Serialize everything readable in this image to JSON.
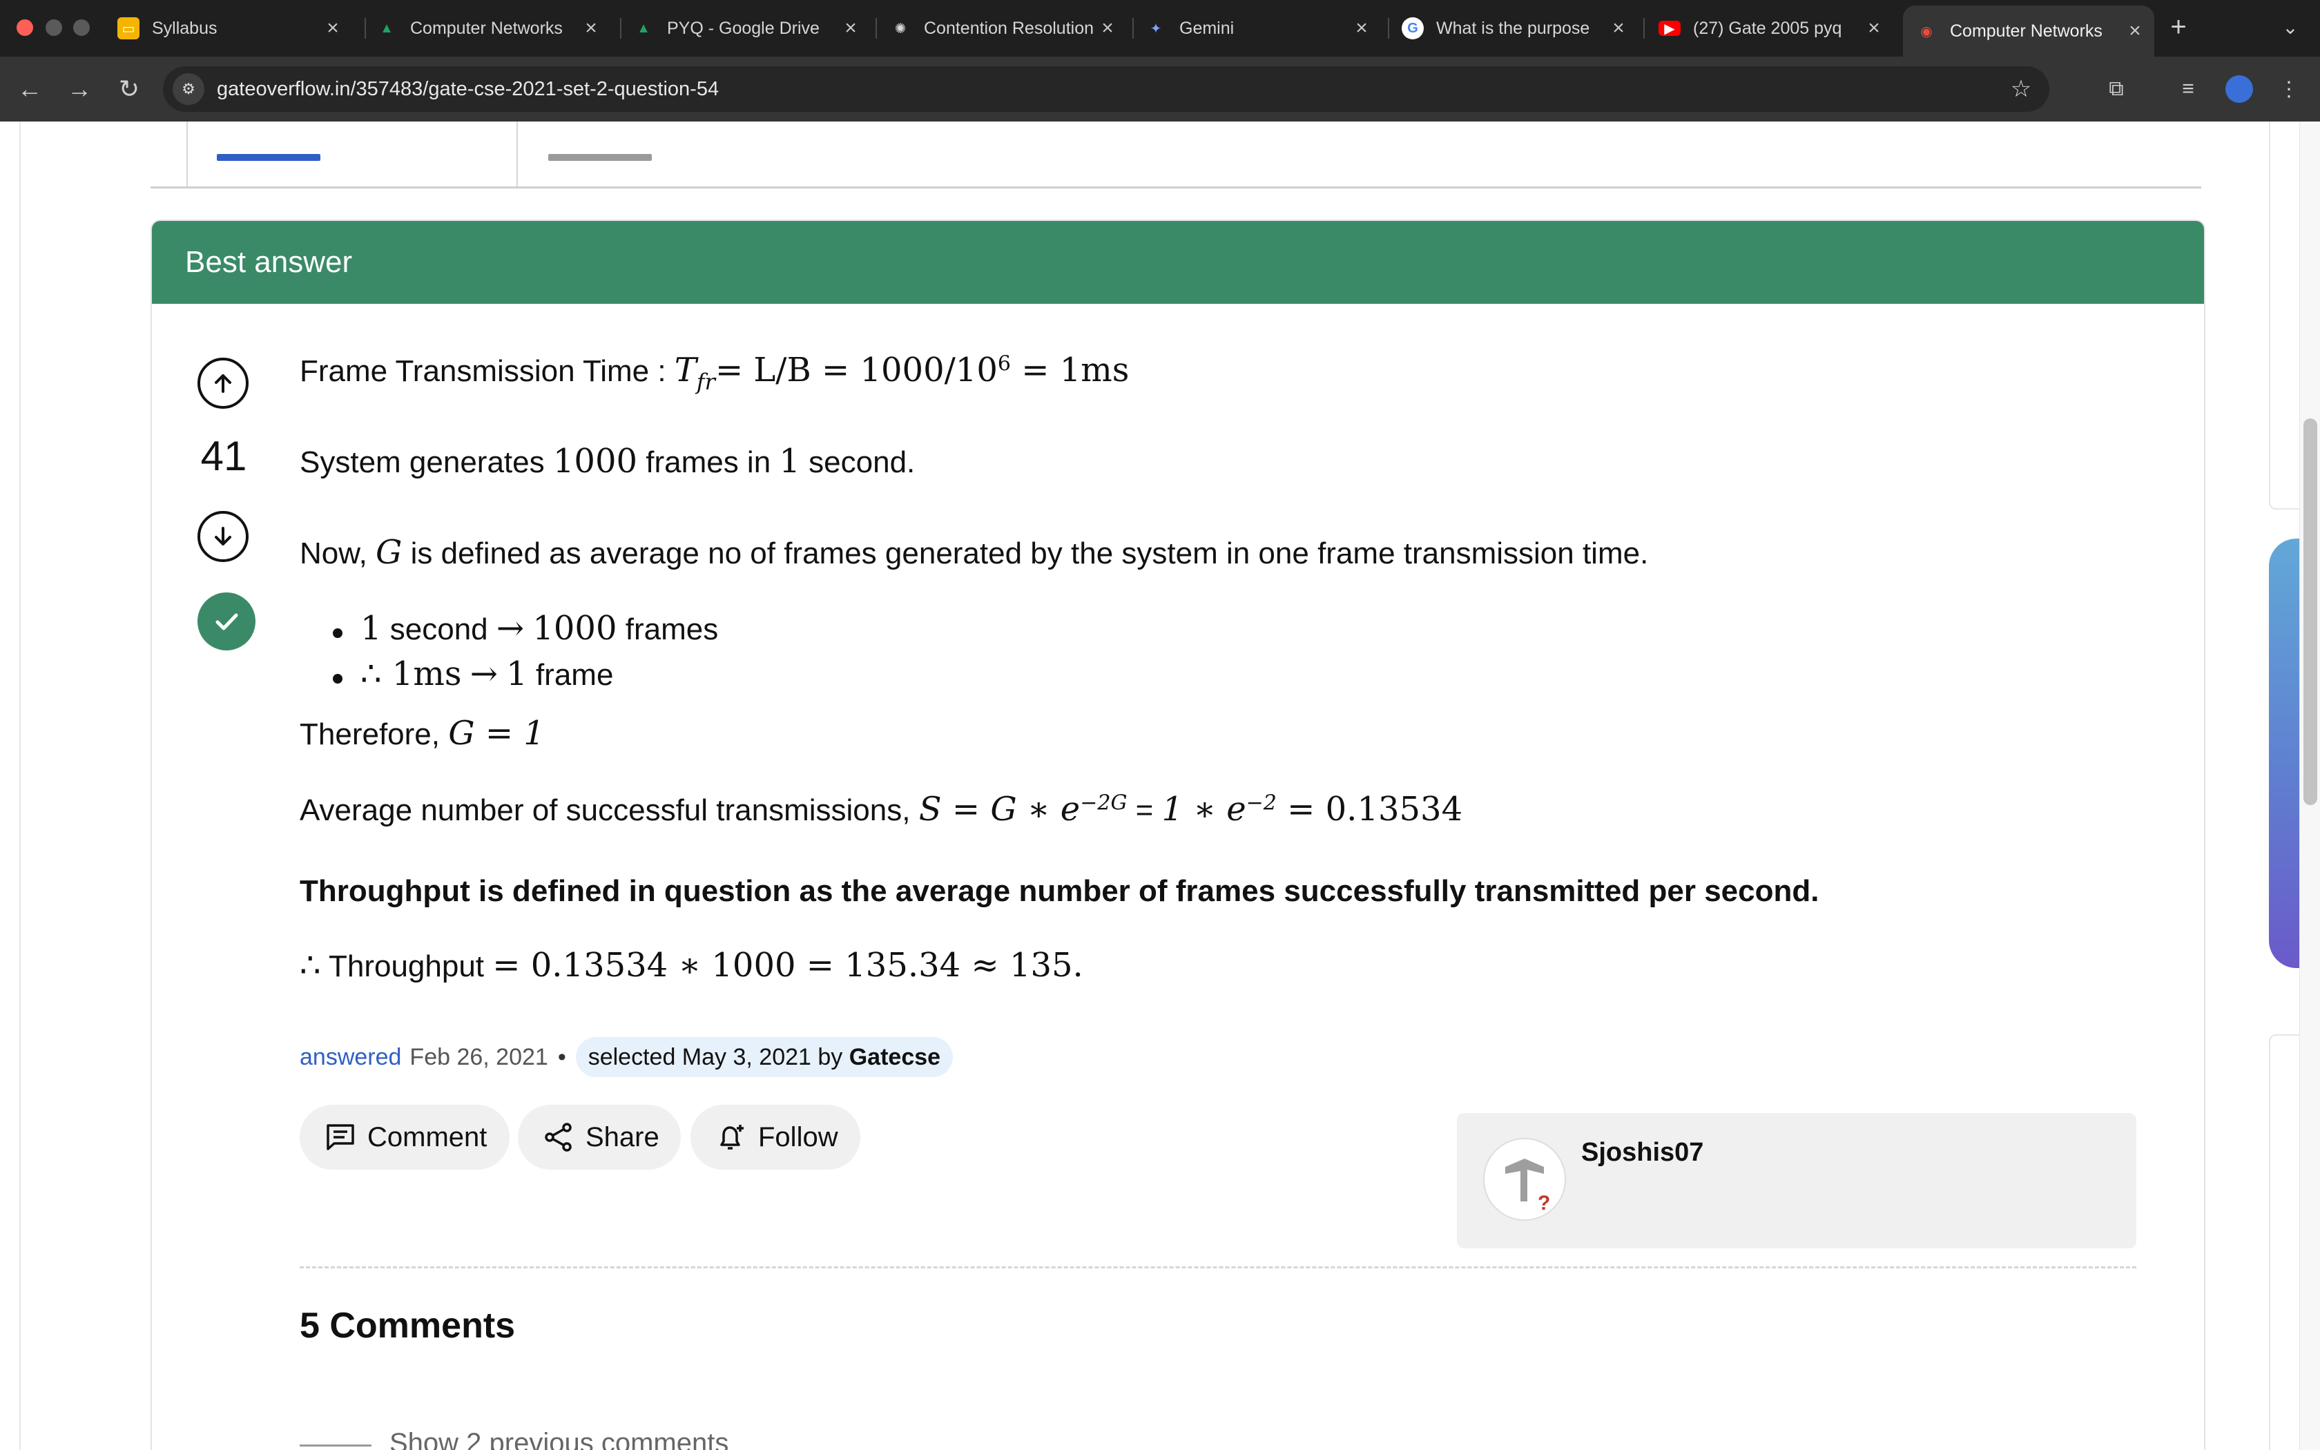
{
  "browser": {
    "tabs": [
      {
        "title": "Syllabus",
        "icon": "slides-icon",
        "color": "#f4b400"
      },
      {
        "title": "Computer Networks",
        "icon": "drive-icon",
        "color": "#1fa463"
      },
      {
        "title": "PYQ - Google Drive",
        "icon": "drive-icon",
        "color": "#1fa463"
      },
      {
        "title": "Contention Resolution",
        "icon": "openai-icon",
        "color": "#d9d9d9"
      },
      {
        "title": "Gemini",
        "icon": "gemini-icon",
        "color": "#7aa2ff"
      },
      {
        "title": "What is the purpose",
        "icon": "google-icon",
        "color": "#ffffff"
      },
      {
        "title": "(27) Gate 2005 pyq",
        "icon": "youtube-icon",
        "color": "#ff0000"
      },
      {
        "title": "Computer Networks",
        "icon": "gateoverflow-icon",
        "color": "#c0392b"
      }
    ],
    "url": "gateoverflow.in/357483/gate-cse-2021-set-2-question-54"
  },
  "answer": {
    "header": "Best answer",
    "votes": "41",
    "line1": {
      "text": "Frame Transmission Time : ",
      "math": "= L/B = 1000/10",
      "exp": "6",
      "math_end": " = 1ms"
    },
    "line2": {
      "pre": "System generates ",
      "n1": "1000",
      "mid": " frames in ",
      "n2": "1",
      "post": " second."
    },
    "line3": {
      "pre": "Now, ",
      "var": "G",
      "post": " is defined as average no of frames generated by the system in one frame transmission time."
    },
    "bullets": [
      {
        "a": "1",
        "b": " second ",
        "arrow": "→",
        "c": "1000",
        "d": " frames"
      },
      {
        "a": "∴ 1ms",
        "b": " ",
        "arrow": "→",
        "c": "1",
        "d": " frame"
      }
    ],
    "line5": {
      "pre": "Therefore,  ",
      "math": "G = 1"
    },
    "line6": {
      "pre": "Average number of successful transmissions, ",
      "math_a": "S = G ∗ e",
      "exp_a": "−2G",
      "mid": " = ",
      "math_b": "1 ∗ e",
      "exp_b": "−2",
      "math_c": " = 0.13534"
    },
    "line7": "Throughput is defined in question as the average number of frames successfully transmitted per second.",
    "line8": {
      "therefore": "∴",
      "pre": " Throughput ",
      "math": "= 0.13534 ∗ 1000 = 135.34 ≈ 135."
    },
    "meta": {
      "answered": "answered",
      "date": "Feb 26, 2021",
      "dot": "•",
      "selected": "selected May 3, 2021 by",
      "by": "Gatecse"
    },
    "actions": {
      "comment": "Comment",
      "share": "Share",
      "follow": "Follow"
    },
    "user": {
      "name": "Sjoshis07"
    }
  },
  "comments": {
    "heading": "5 Comments",
    "show_previous": "Show 2 previous comments"
  }
}
